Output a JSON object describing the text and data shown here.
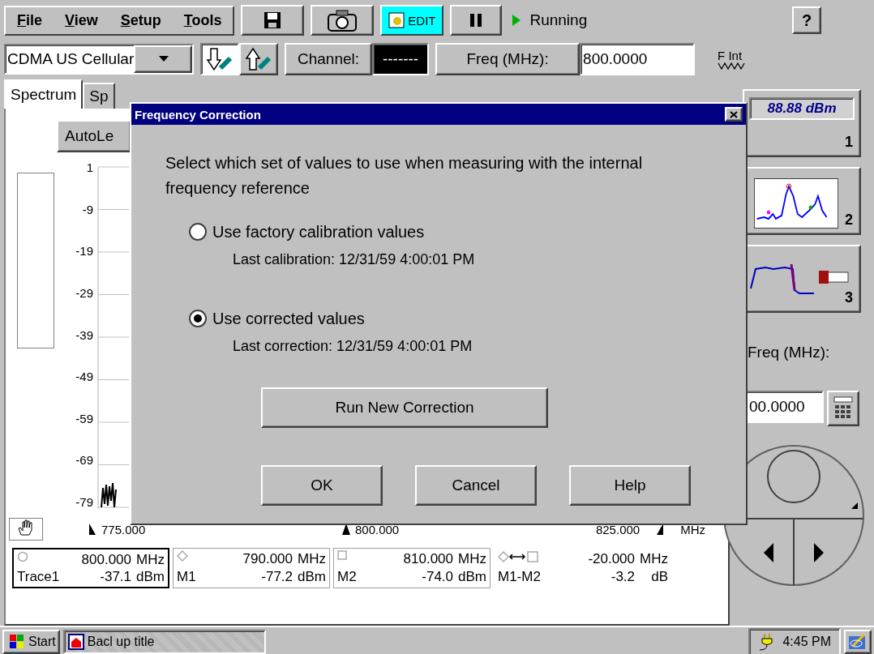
{
  "menu": [
    {
      "label": "File"
    },
    {
      "label": "View"
    },
    {
      "label": "Setup"
    },
    {
      "label": "Tools"
    }
  ],
  "toolbar": {
    "edit_label": "EDIT",
    "paused_state": "Running",
    "help": "?"
  },
  "standard": {
    "value": "CDMA US Cellular"
  },
  "channel": {
    "label": "Channel:",
    "value": "-------"
  },
  "frequency": {
    "label": "Freq (MHz):",
    "value": "800.0000"
  },
  "reference": {
    "label": "F Int"
  },
  "tabs": [
    {
      "label": "Spectrum",
      "selected": true
    },
    {
      "label": "Sp",
      "selected": false
    }
  ],
  "autolevel": {
    "label": "AutoLe"
  },
  "y_ticks": [
    "1",
    "-9",
    "-19",
    "-29",
    "-39",
    "-49",
    "-59",
    "-69",
    "-79"
  ],
  "x_labels": {
    "start": "775.000",
    "center": "800.000",
    "end": "825.000",
    "unit": "MHz"
  },
  "markers": [
    {
      "kind": "trace",
      "selected": true,
      "frequency": "800.000",
      "frequency_unit": "MHz",
      "name": "Trace1",
      "level": "-37.1",
      "level_unit": "dBm"
    },
    {
      "kind": "marker1",
      "selected": false,
      "frequency": "790.000",
      "frequency_unit": "MHz",
      "name": "M1",
      "level": "-77.2",
      "level_unit": "dBm"
    },
    {
      "kind": "marker2",
      "selected": false,
      "frequency": "810.000",
      "frequency_unit": "MHz",
      "name": "M2",
      "level": "-74.0",
      "level_unit": "dBm"
    },
    {
      "kind": "delta",
      "selected": false,
      "frequency": "-20.000",
      "frequency_unit": "MHz",
      "name": "M1-M2",
      "level": "-3.2",
      "level_unit": "dB"
    }
  ],
  "side_buttons": [
    {
      "kind": "readout",
      "readout": "88.88 dBm",
      "number": "1"
    },
    {
      "kind": "spectrum",
      "number": "2"
    },
    {
      "kind": "channel_power",
      "number": "3"
    }
  ],
  "side_freq": {
    "label": "Freq (MHz):",
    "value": "00.0000"
  },
  "dialog": {
    "title": "Frequency Correction",
    "message": "Select which set of values to use when measuring with the internal frequency reference",
    "options": [
      {
        "label": "Use factory calibration values",
        "detail": "Last calibration: 12/31/59 4:00:01 PM",
        "selected": false
      },
      {
        "label": "Use corrected values",
        "detail": "Last correction: 12/31/59 4:00:01 PM",
        "selected": true
      }
    ],
    "action": "Run New Correction",
    "buttons": [
      "OK",
      "Cancel",
      "Help"
    ]
  },
  "taskbar": {
    "start": "Start",
    "task": "Bacl up title",
    "time": "4:45 PM"
  }
}
